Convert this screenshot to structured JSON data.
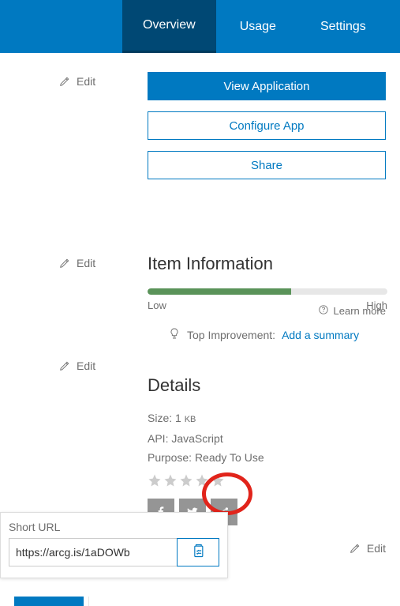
{
  "nav": {
    "tabs": [
      "Overview",
      "Usage",
      "Settings"
    ],
    "active_index": 0
  },
  "actions": {
    "edit_label": "Edit",
    "view_app": "View Application",
    "configure": "Configure App",
    "share": "Share"
  },
  "item_info": {
    "title": "Item Information",
    "learn_more": "Learn more",
    "progress_percent": 60,
    "low_label": "Low",
    "high_label": "High",
    "top_improvement_label": "Top Improvement:",
    "improvement_link": "Add a summary"
  },
  "details": {
    "title": "Details",
    "size_label": "Size:",
    "size_value": "1",
    "size_unit": "KB",
    "api_label": "API:",
    "api_value": "JavaScript",
    "purpose_label": "Purpose:",
    "purpose_value": "Ready To Use",
    "rating_stars": 0
  },
  "share_popover": {
    "title": "Short URL",
    "url": "https://arcg.is/1aDOWb"
  },
  "icons": {
    "pencil": "pencil-icon",
    "help": "help-icon",
    "bulb": "lightbulb-icon",
    "facebook": "facebook-icon",
    "twitter": "twitter-icon",
    "share_generic": "share-icon",
    "clipboard": "clipboard-icon"
  },
  "colors": {
    "brand_blue": "#0079c1",
    "dark_blue": "#004874",
    "progress_green": "#5a9359",
    "annotation_red": "#e1241b",
    "gray_text": "#6e6e6e",
    "icon_gray": "#959595"
  }
}
